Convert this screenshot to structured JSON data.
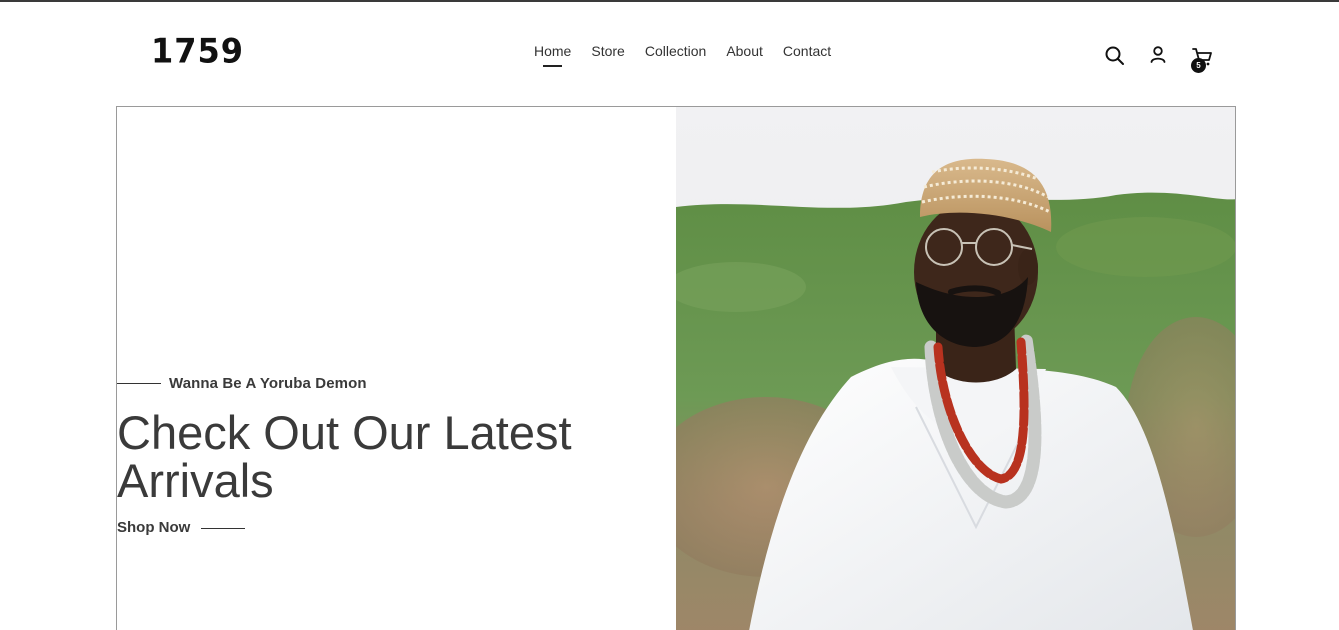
{
  "header": {
    "logo": "1759",
    "nav": [
      {
        "label": "Home",
        "active": true
      },
      {
        "label": "Store",
        "active": false
      },
      {
        "label": "Collection",
        "active": false
      },
      {
        "label": "About",
        "active": false
      },
      {
        "label": "Contact",
        "active": false
      }
    ],
    "icons": [
      "search-icon",
      "user-icon",
      "cart-icon"
    ],
    "cart_count": "5"
  },
  "hero": {
    "eyebrow": "Wanna Be A Yoruba Demon",
    "headline": "Check Out Our Latest Arrivals",
    "cta": "Shop Now",
    "image": "portrait of a man in white agbada, beaded cap, glasses and coral bead necklace against blurred green hillside"
  }
}
